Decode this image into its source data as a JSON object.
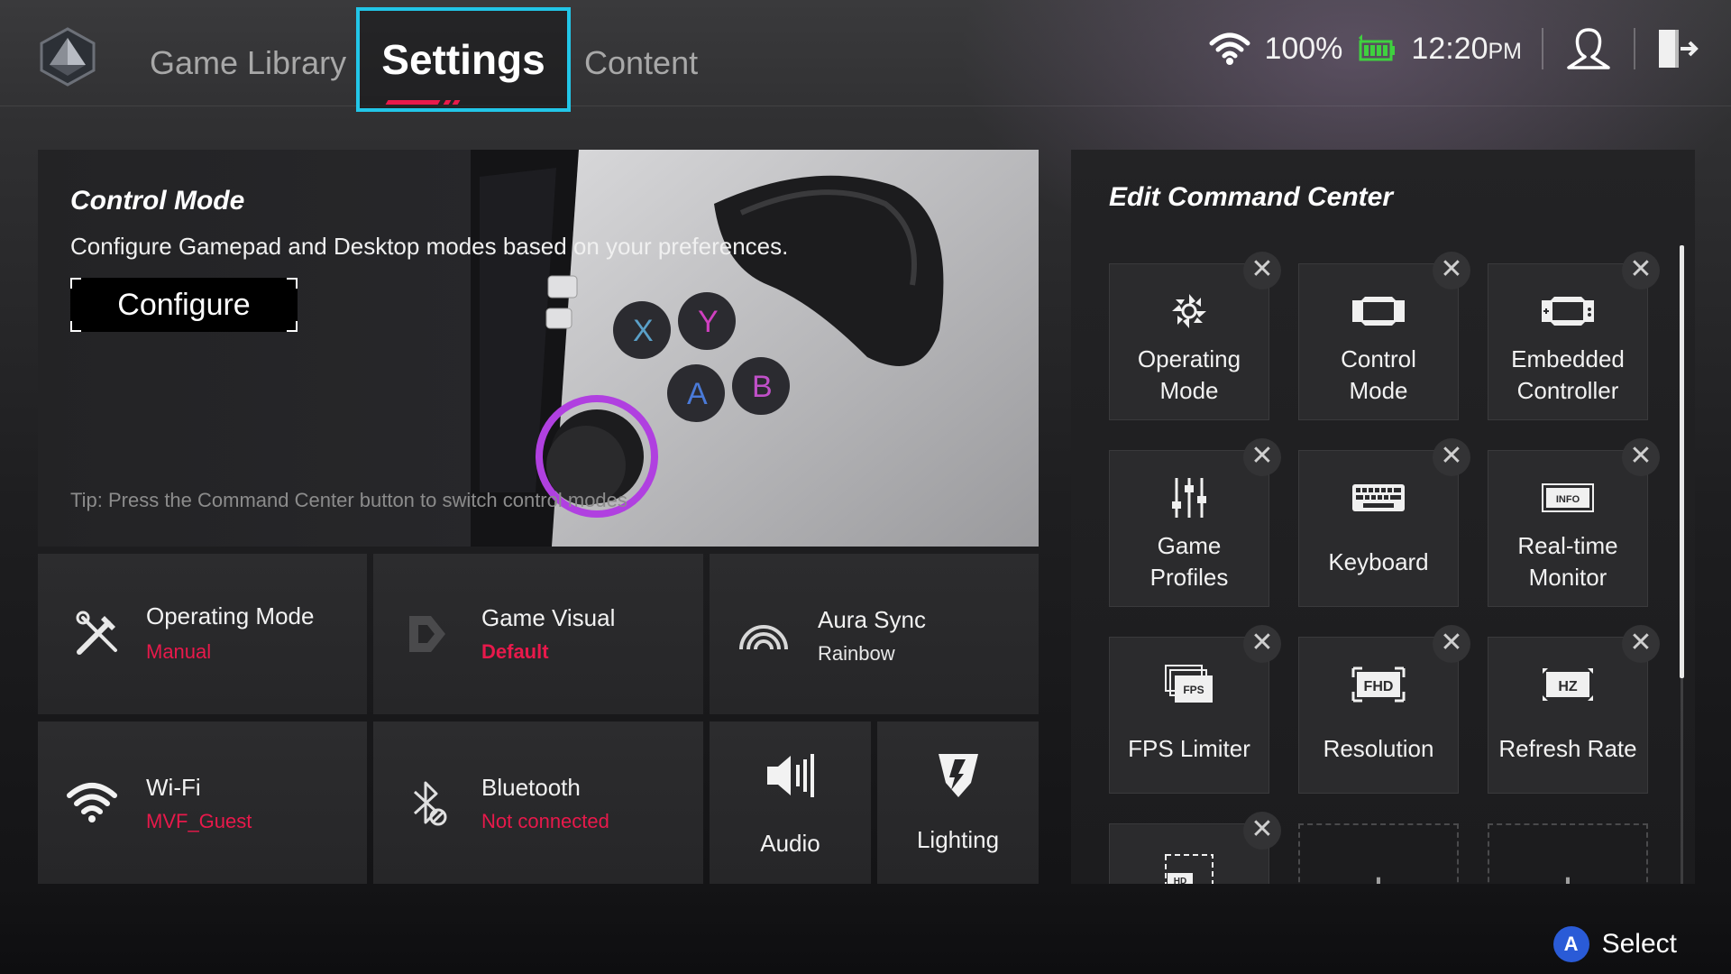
{
  "nav": {
    "tabs": [
      {
        "label": "Game Library"
      },
      {
        "label": "Settings"
      },
      {
        "label": "Content"
      }
    ]
  },
  "status": {
    "battery": "100%",
    "time": "12:20",
    "time_suffix": "PM"
  },
  "control_mode": {
    "title": "Control Mode",
    "description": "Configure Gamepad and Desktop modes based on your preferences.",
    "button": "Configure",
    "tip": "Tip: Press the Command Center button to switch control modes"
  },
  "tiles": {
    "operating_mode": {
      "label": "Operating Mode",
      "value": "Manual"
    },
    "game_visual": {
      "label": "Game Visual",
      "value": "Default"
    },
    "aura_sync": {
      "label": "Aura Sync",
      "value": "Rainbow"
    },
    "wifi": {
      "label": "Wi-Fi",
      "value": "MVF_Guest"
    },
    "bluetooth": {
      "label": "Bluetooth",
      "value": "Not connected"
    },
    "audio": {
      "label": "Audio"
    },
    "lighting": {
      "label": "Lighting"
    }
  },
  "command_center": {
    "title": "Edit Command Center",
    "items": [
      {
        "label_1": "Operating",
        "label_2": "Mode",
        "icon": "fan-icon"
      },
      {
        "label_1": "Control",
        "label_2": "Mode",
        "icon": "handheld-icon"
      },
      {
        "label_1": "Embedded",
        "label_2": "Controller",
        "icon": "controller-icon"
      },
      {
        "label_1": "Game",
        "label_2": "Profiles",
        "icon": "sliders-icon"
      },
      {
        "label": "Keyboard",
        "icon": "keyboard-icon"
      },
      {
        "label_1": "Real-time",
        "label_2": "Monitor",
        "icon": "info-icon",
        "icon_text": "INFO"
      },
      {
        "label": "FPS Limiter",
        "icon": "fps-icon",
        "icon_text": "FPS"
      },
      {
        "label": "Resolution",
        "icon": "fhd-icon",
        "icon_text": "FHD"
      },
      {
        "label": "Refresh Rate",
        "icon": "hz-icon",
        "icon_text": "HZ"
      },
      {
        "icon": "hd-icon",
        "icon_text": "HD"
      }
    ],
    "remove_glyph": "✕",
    "add_glyph": "+"
  },
  "device_art": {
    "face_buttons": [
      "X",
      "Y",
      "A",
      "B"
    ]
  },
  "footer": {
    "button_glyph": "A",
    "label": "Select"
  },
  "colors": {
    "accent_red": "#e8194b",
    "focus_cyan": "#22c6e8",
    "a_button_blue": "#2a5bd7"
  }
}
